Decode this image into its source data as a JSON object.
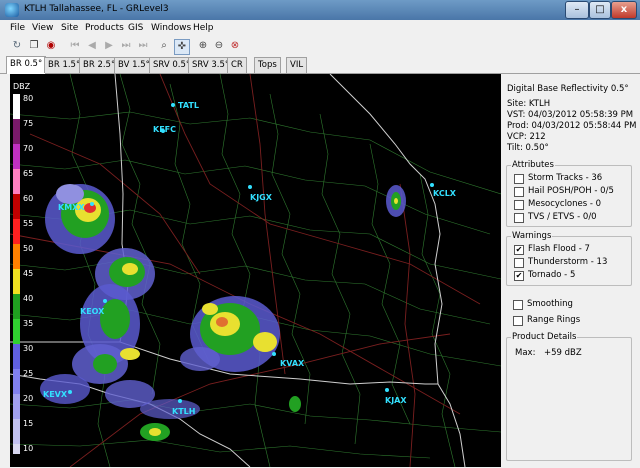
{
  "window": {
    "title": "KTLH Tallahassee, FL - GRLevel3",
    "minimize_glyph": "–",
    "maximize_glyph": "□",
    "close_glyph": "x"
  },
  "menu": [
    "File",
    "View",
    "Site",
    "Products",
    "GIS",
    "Windows",
    "Help"
  ],
  "toolbar_icons": [
    "refresh-icon",
    "copy-icon",
    "record-icon",
    "first-frame-icon",
    "previous-frame-icon",
    "play-icon",
    "next-frame-icon",
    "last-frame-icon",
    "zoom-icon",
    "pan-icon",
    "zoom-in-icon",
    "zoom-out-icon",
    "zoom-reset-icon"
  ],
  "tabs": [
    "BR 0.5°",
    "BR 1.5°",
    "BR 2.5°",
    "BV 1.5°",
    "SRV 0.5°",
    "SRV 3.5°",
    "CR",
    "Tops",
    "VIL"
  ],
  "legend": {
    "unit": "DBZ",
    "ticks": [
      "80",
      "75",
      "70",
      "65",
      "60",
      "55",
      "50",
      "45",
      "40",
      "35",
      "30",
      "25",
      "20",
      "15",
      "10"
    ]
  },
  "sites": [
    {
      "id": "KTLH",
      "label": "KTLH"
    },
    {
      "id": "KMXX",
      "label": "KMXX"
    },
    {
      "id": "KEOX",
      "label": "KEOX"
    },
    {
      "id": "KEVX",
      "label": "KEVX"
    },
    {
      "id": "KVAX",
      "label": "KVAX"
    },
    {
      "id": "KJAX",
      "label": "KJAX"
    },
    {
      "id": "KJGX",
      "label": "KJGX"
    },
    {
      "id": "KCLX",
      "label": "KCLX"
    },
    {
      "id": "KFFC",
      "label": "KFFC"
    },
    {
      "id": "TATL",
      "label": "TATL"
    }
  ],
  "info": {
    "product": "Digital Base Reflectivity 0.5°",
    "site": "Site:  KTLH",
    "vst": "VST:  04/03/2012  05:58:39 PM",
    "prod": "Prod:  04/03/2012  05:58:44 PM",
    "vcp": "VCP:  212",
    "tilt": "Tilt:   0.50°"
  },
  "attributes": {
    "title": "Attributes",
    "items": [
      {
        "label": "Storm Tracks - 36",
        "checked": false
      },
      {
        "label": "Hail POSH/POH - 0/5",
        "checked": false
      },
      {
        "label": "Mesocyclones - 0",
        "checked": false
      },
      {
        "label": "TVS / ETVS - 0/0",
        "checked": false
      }
    ]
  },
  "warnings": {
    "title": "Warnings",
    "items": [
      {
        "label": "Flash Flood - 7",
        "checked": true
      },
      {
        "label": "Thunderstorm - 13",
        "checked": false
      },
      {
        "label": "Tornado - 5",
        "checked": true
      }
    ]
  },
  "options": [
    {
      "label": "Smoothing",
      "checked": false
    },
    {
      "label": "Range Rings",
      "checked": false
    }
  ],
  "details": {
    "title": "Product Details",
    "max_label": "Max:",
    "max_value": "+59 dBZ"
  },
  "colors": {
    "site_label": "#33e0ff",
    "county_lines": "#2f7a2f",
    "state_lines": "#cfcfcf",
    "roads": "#7a1f1f",
    "check_mark": "✔"
  }
}
